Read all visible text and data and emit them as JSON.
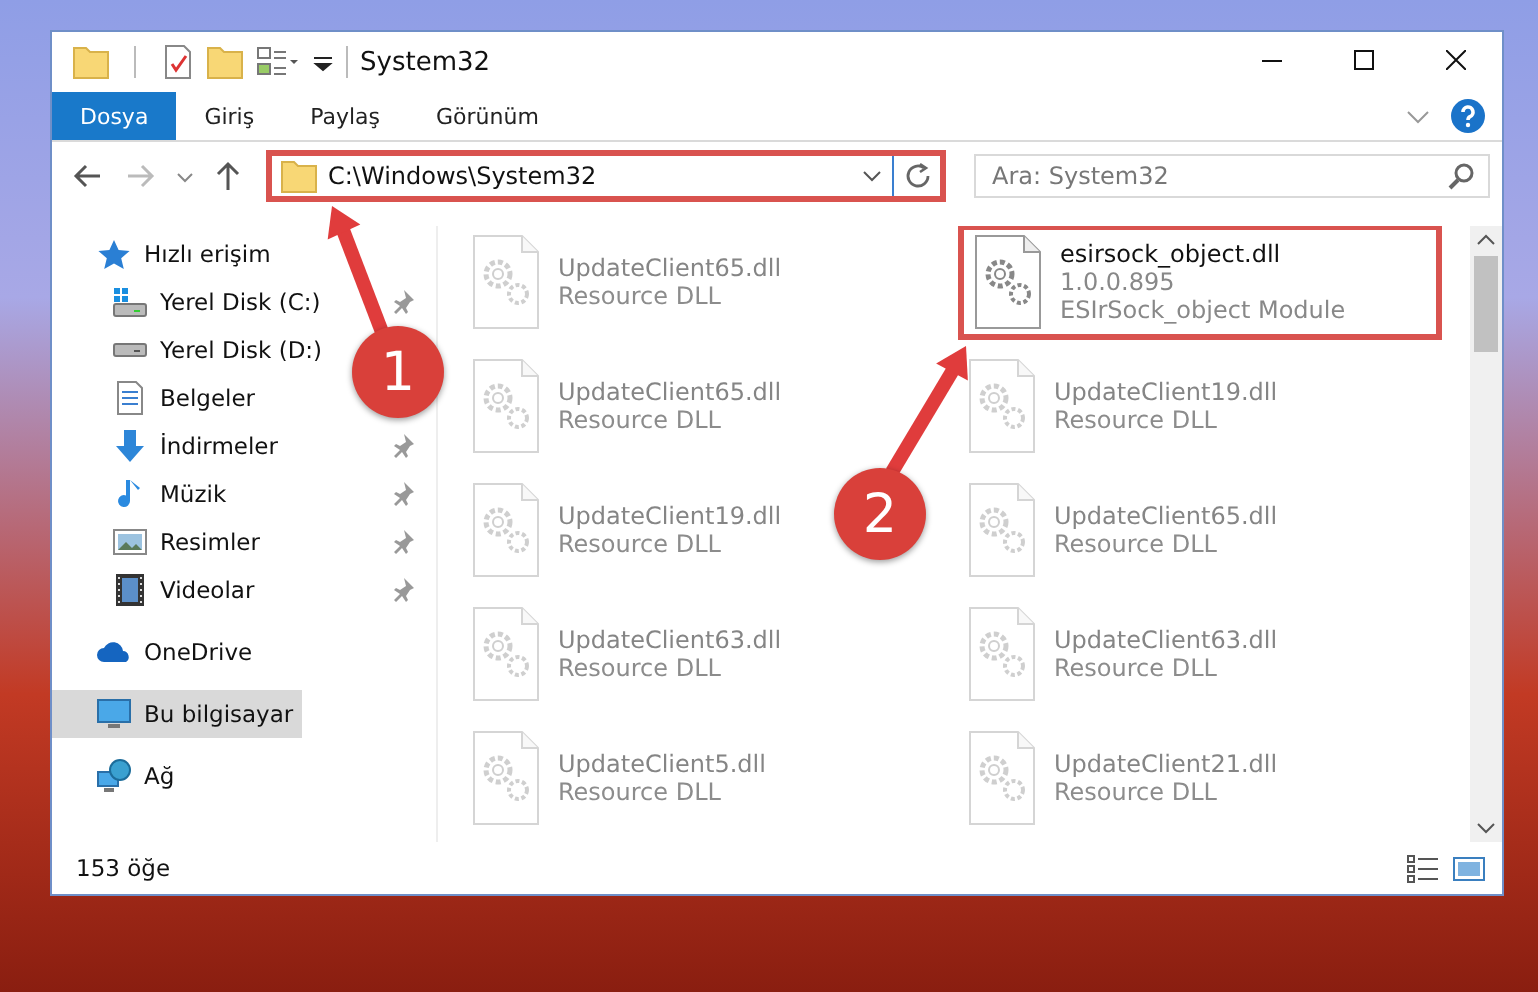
{
  "window": {
    "title": "System32"
  },
  "ribbon_tabs": [
    {
      "label": "Dosya",
      "selected": true
    },
    {
      "label": "Giriş",
      "selected": false
    },
    {
      "label": "Paylaş",
      "selected": false
    },
    {
      "label": "Görünüm",
      "selected": false
    }
  ],
  "address": {
    "path": "C:\\Windows\\System32",
    "highlighted": true
  },
  "search": {
    "placeholder": "Ara: System32"
  },
  "sidebar": {
    "items": [
      {
        "label": "Hızlı erişim",
        "kind": "star",
        "selected": false,
        "children": [
          {
            "label": "Yerel Disk (C:)",
            "kind": "drive-windows",
            "selected": false,
            "pinned": true
          },
          {
            "label": "Yerel Disk (D:)",
            "kind": "drive",
            "selected": false,
            "pinned": false
          },
          {
            "label": "Belgeler",
            "kind": "document",
            "selected": false,
            "pinned": false
          },
          {
            "label": "İndirmeler",
            "kind": "download",
            "selected": false,
            "pinned": true
          },
          {
            "label": "Müzik",
            "kind": "music",
            "selected": false,
            "pinned": true
          },
          {
            "label": "Resimler",
            "kind": "picture",
            "selected": false,
            "pinned": true
          },
          {
            "label": "Videolar",
            "kind": "video",
            "selected": false,
            "pinned": true
          }
        ]
      },
      {
        "label": "OneDrive",
        "kind": "cloud",
        "selected": false
      },
      {
        "label": "Bu bilgisayar",
        "kind": "computer",
        "selected": true
      },
      {
        "label": "Ağ",
        "kind": "network",
        "selected": false
      }
    ]
  },
  "files": [
    {
      "name": "UpdateClient65.dll",
      "type": "Resource DLL",
      "highlighted": false
    },
    {
      "name": "esirsock_object.dll",
      "version": "1.0.0.895",
      "type": "ESIrSock_object Module",
      "highlighted": true
    },
    {
      "name": "UpdateClient65.dll",
      "type": "Resource DLL",
      "highlighted": false
    },
    {
      "name": "UpdateClient19.dll",
      "type": "Resource DLL",
      "highlighted": false
    },
    {
      "name": "UpdateClient19.dll",
      "type": "Resource DLL",
      "highlighted": false
    },
    {
      "name": "UpdateClient65.dll",
      "type": "Resource DLL",
      "highlighted": false
    },
    {
      "name": "UpdateClient63.dll",
      "type": "Resource DLL",
      "highlighted": false
    },
    {
      "name": "UpdateClient63.dll",
      "type": "Resource DLL",
      "highlighted": false
    },
    {
      "name": "UpdateClient5.dll",
      "type": "Resource DLL",
      "highlighted": false
    },
    {
      "name": "UpdateClient21.dll",
      "type": "Resource DLL",
      "highlighted": false
    }
  ],
  "status_bar": {
    "item_count": "153 öğe"
  },
  "annotations": [
    {
      "number": "1"
    },
    {
      "number": "2"
    }
  ]
}
